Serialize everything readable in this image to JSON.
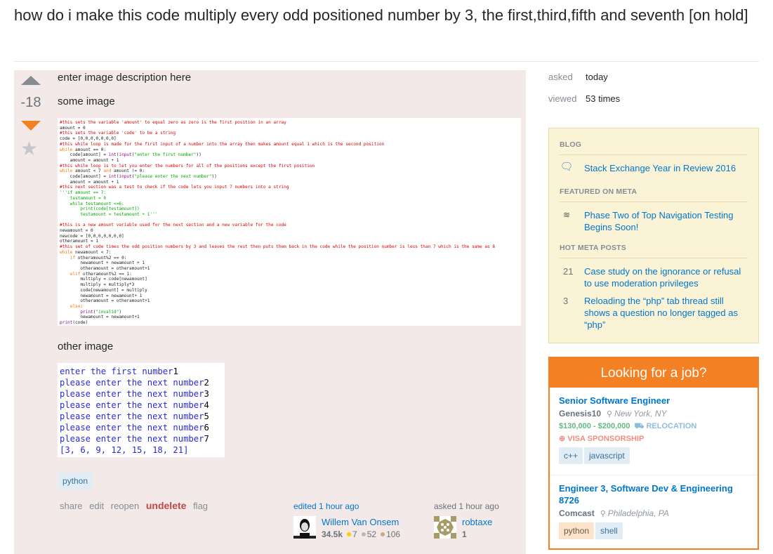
{
  "question": {
    "title": "how do i make this code multiply every odd positioned number by 3, the first,third,fifth and seventh [on hold]",
    "vote_count": "-18",
    "body": {
      "line1": "enter image description here",
      "line2": "some image",
      "line3": "other image"
    },
    "code_image_lines": [
      [
        {
          "t": "#this sets the variable 'amount' to equal zero as zero is the first position in an array",
          "c": "cm"
        }
      ],
      [
        {
          "t": "amount = 0"
        }
      ],
      [
        {
          "t": "#this sets the variable 'code' to be a string",
          "c": "cm"
        }
      ],
      [
        {
          "t": "code = [0,0,0,0,0,0,0]"
        }
      ],
      [
        {
          "t": "#this while loop is made for the first input of a number into the array then makes amount equal 1 which is the second position",
          "c": "cm"
        }
      ],
      [
        {
          "t": "while",
          "c": "kw"
        },
        {
          "t": " amount == 0:"
        }
      ],
      [
        {
          "t": "    code[amount] = "
        },
        {
          "t": "int",
          "c": "bi"
        },
        {
          "t": "("
        },
        {
          "t": "input",
          "c": "bi"
        },
        {
          "t": "("
        },
        {
          "t": "\"enter the first number\"",
          "c": "st"
        },
        {
          "t": "))"
        }
      ],
      [
        {
          "t": "    amount = amount + 1"
        }
      ],
      [
        {
          "t": "#this while loop is to let you enter the numbers for all of the positions except the first position",
          "c": "cm"
        }
      ],
      [
        {
          "t": "while",
          "c": "kw"
        },
        {
          "t": " amount < 7 "
        },
        {
          "t": "and",
          "c": "kw"
        },
        {
          "t": " amount != 0:"
        }
      ],
      [
        {
          "t": "    code[amount] = "
        },
        {
          "t": "int",
          "c": "bi"
        },
        {
          "t": "("
        },
        {
          "t": "input",
          "c": "bi"
        },
        {
          "t": "("
        },
        {
          "t": "\"please enter the next number\"",
          "c": "st"
        },
        {
          "t": "))"
        }
      ],
      [
        {
          "t": "    amount = amount + 1"
        }
      ],
      [
        {
          "t": "#this next section was a test to check if the code lets you input 7 numbers into a string",
          "c": "cm"
        }
      ],
      [
        {
          "t": "'''if amount == 7:",
          "c": "st"
        }
      ],
      [
        {
          "t": "    testamount = 0",
          "c": "st"
        }
      ],
      [
        {
          "t": "    while testamount <=6:",
          "c": "st"
        }
      ],
      [
        {
          "t": "        print(code[testamount])",
          "c": "st"
        }
      ],
      [
        {
          "t": "        testamount = testamount + 1'''",
          "c": "st"
        }
      ],
      [
        {
          "t": ""
        }
      ],
      [
        {
          "t": "#this is a new amount variable used for the next section and a new variable for the code",
          "c": "cm"
        }
      ],
      [
        {
          "t": "newamount = 0"
        }
      ],
      [
        {
          "t": "newcode = [0,0,0,0,0,0,0]"
        }
      ],
      [
        {
          "t": "otheramount = 1"
        }
      ],
      [
        {
          "t": "#this set of code times the odd position numbers by 3 and leaves the rest then puts them back in the code while the position number is less than 7 which is the same as 8",
          "c": "cm"
        }
      ],
      [
        {
          "t": "while",
          "c": "kw"
        },
        {
          "t": " newamount < 7:"
        }
      ],
      [
        {
          "t": "    "
        },
        {
          "t": "if",
          "c": "kw"
        },
        {
          "t": " otheramount%2 == 0:"
        }
      ],
      [
        {
          "t": "        newamount + newamount + 1"
        }
      ],
      [
        {
          "t": "        otheramount = otheramount+1"
        }
      ],
      [
        {
          "t": "    "
        },
        {
          "t": "elif",
          "c": "kw"
        },
        {
          "t": " otheramount%2 == 1:"
        }
      ],
      [
        {
          "t": "        multiply = code[newamount]"
        }
      ],
      [
        {
          "t": "        multiply = multiply*3"
        }
      ],
      [
        {
          "t": "        code[newamount] = multiply"
        }
      ],
      [
        {
          "t": "        newamount = newamount+ 1"
        }
      ],
      [
        {
          "t": "        otheramount = otheramount+1"
        }
      ],
      [
        {
          "t": "    "
        },
        {
          "t": "else",
          "c": "kw"
        },
        {
          "t": ":"
        }
      ],
      [
        {
          "t": "        "
        },
        {
          "t": "print",
          "c": "bi"
        },
        {
          "t": "("
        },
        {
          "t": "\"invalid\"",
          "c": "st"
        },
        {
          "t": ")"
        }
      ],
      [
        {
          "t": "        newamount = newamount+1"
        }
      ],
      [
        {
          "t": "print",
          "c": "bi"
        },
        {
          "t": "(code)"
        }
      ]
    ],
    "output_image_lines": [
      {
        "prompt": "enter the first number",
        "input": "1"
      },
      {
        "prompt": "please enter the next number",
        "input": "2"
      },
      {
        "prompt": "please enter the next number",
        "input": "3"
      },
      {
        "prompt": "please enter the next number",
        "input": "4"
      },
      {
        "prompt": "please enter the next number",
        "input": "5"
      },
      {
        "prompt": "please enter the next number",
        "input": "6"
      },
      {
        "prompt": "please enter the next number",
        "input": "7"
      },
      {
        "prompt": "[3, 6, 9, 12, 15, 18, 21]",
        "input": ""
      }
    ],
    "tags": [
      "python"
    ],
    "menu": {
      "share": "share",
      "edit": "edit",
      "reopen": "reopen",
      "undelete": "undelete",
      "flag": "flag"
    },
    "editor": {
      "action": "edited 1 hour ago",
      "name": "Willem Van Onsem",
      "reputation": "34.5k",
      "gold": "7",
      "silver": "52",
      "bronze": "106"
    },
    "owner": {
      "action": "asked 1 hour ago",
      "name": "robtaxe",
      "reputation": "1"
    }
  },
  "sidebar": {
    "asked_label": "asked",
    "asked_value": "today",
    "viewed_label": "viewed",
    "viewed_value": "53 times",
    "bulletin": {
      "blog_heading": "BLOG",
      "blog_item": "Stack Exchange Year in Review 2016",
      "featured_heading": "FEATURED ON META",
      "featured_item": "Phase Two of Top Navigation Testing Begins Soon!",
      "hot_heading": "HOT META POSTS",
      "hot_items": [
        {
          "count": "21",
          "title": "Case study on the ignorance or refusal to use moderation privileges"
        },
        {
          "count": "3",
          "title": "Reloading the “php” tab thread still shows a question no longer tagged as “php”"
        }
      ]
    },
    "jobs": {
      "heading": "Looking for a job?",
      "listings": [
        {
          "title": "Senior Software Engineer",
          "company": "Genesis10",
          "location": "New York, NY",
          "salary": "$130,000 - $200,000",
          "relocation": "RELOCATION",
          "visa": "VISA SPONSORSHIP",
          "tags": [
            "c++",
            "javascript"
          ]
        },
        {
          "title": "Engineer 3, Software Dev & Engineering 8726",
          "company": "Comcast",
          "location": "Philadelphia, PA",
          "tags": [
            "python",
            "shell"
          ]
        }
      ]
    }
  },
  "colors": {
    "accent_orange": "#f48024",
    "link_blue": "#0077cc",
    "deleted_post_bg": "#f4e9e9",
    "bulletin_bg": "#fbf3d5"
  }
}
